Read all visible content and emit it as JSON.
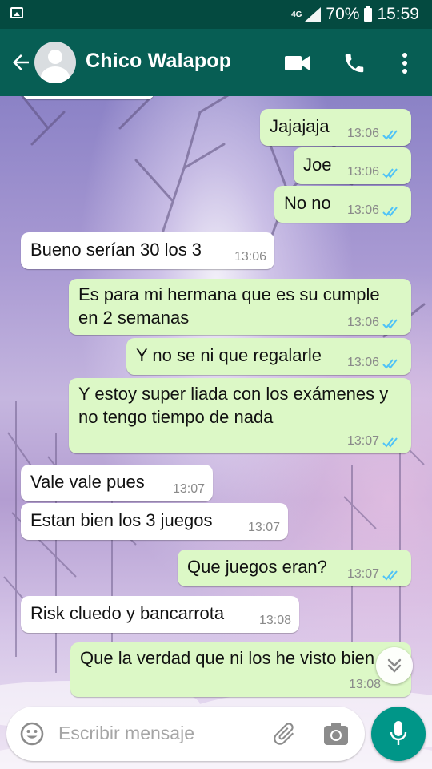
{
  "status_bar": {
    "network": "4G",
    "battery": "70%",
    "time": "15:59"
  },
  "header": {
    "contact_name": "Chico Walapop"
  },
  "messages": [
    {
      "dir": "out",
      "text": "Jajajaja",
      "time": "13:06"
    },
    {
      "dir": "out",
      "text": "Joe",
      "time": "13:06"
    },
    {
      "dir": "out",
      "text": "No no",
      "time": "13:06"
    },
    {
      "dir": "in",
      "text": "Bueno serían 30 los 3",
      "time": "13:06"
    },
    {
      "dir": "out",
      "text": "Es para mi hermana que es su cumple en 2 semanas",
      "time": "13:06"
    },
    {
      "dir": "out",
      "text": "Y no se ni que regalarle",
      "time": "13:06"
    },
    {
      "dir": "out",
      "text": "Y estoy super liada con los exámenes y no tengo tiempo de nada",
      "time": "13:07"
    },
    {
      "dir": "in",
      "text": "Vale vale pues",
      "time": "13:07"
    },
    {
      "dir": "in",
      "text": "Estan bien los 3 juegos",
      "time": "13:07"
    },
    {
      "dir": "out",
      "text": "Que juegos eran?",
      "time": "13:07"
    },
    {
      "dir": "in",
      "text": "Risk cluedo y bancarrota",
      "time": "13:08"
    },
    {
      "dir": "out",
      "text": "Que la verdad que ni los he visto bien",
      "time": "13:08"
    }
  ],
  "input": {
    "placeholder": "Escribir mensaje"
  },
  "colors": {
    "header": "#075e54",
    "status_bar": "#044a40",
    "outgoing_bubble": "#dcf8c6",
    "incoming_bubble": "#ffffff",
    "read_ticks": "#4fc3f7",
    "mic_button": "#009688"
  },
  "icons": {
    "status_image": "image-icon",
    "back": "arrow-left-icon",
    "video": "video-camera-icon",
    "call": "phone-icon",
    "menu": "more-vertical-icon",
    "emoji": "emoji-icon",
    "attach": "paperclip-icon",
    "camera": "camera-icon",
    "mic": "microphone-icon",
    "scroll": "chevron-double-down-icon"
  }
}
